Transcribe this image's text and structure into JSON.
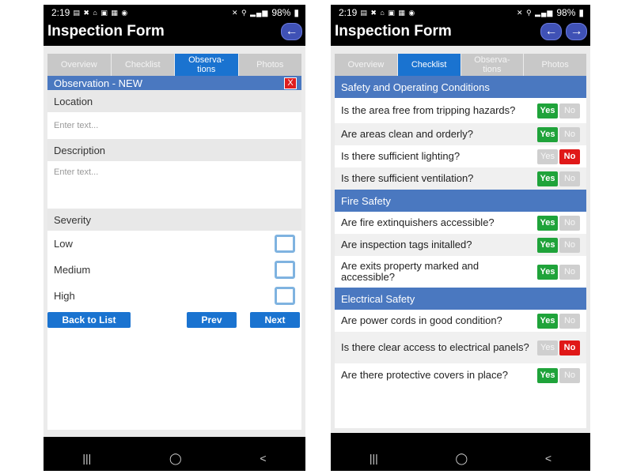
{
  "status": {
    "time": "2:19",
    "battery": "98%"
  },
  "app": {
    "title": "Inspection Form"
  },
  "tabs": [
    "Overview",
    "Checklist",
    "Observa-\ntions",
    "Photos"
  ],
  "left": {
    "observation_header": "Observation - NEW",
    "close_label": "X",
    "location_label": "Location",
    "location_placeholder": "Enter text...",
    "description_label": "Description",
    "description_placeholder": "Enter text...",
    "severity_label": "Severity",
    "severity_options": [
      "Low",
      "Medium",
      "High"
    ],
    "back_label": "Back to List",
    "prev_label": "Prev",
    "next_label": "Next"
  },
  "checklist": {
    "yes_label": "Yes",
    "no_label": "No",
    "sections": [
      {
        "title": "Safety and Operating Conditions",
        "items": [
          {
            "q": "Is the area free from tripping hazards?",
            "answer": "yes"
          },
          {
            "q": "Are areas clean and orderly?",
            "answer": "yes"
          },
          {
            "q": "Is there sufficient lighting?",
            "answer": "no"
          },
          {
            "q": "Is there sufficient ventilation?",
            "answer": "yes"
          }
        ]
      },
      {
        "title": "Fire Safety",
        "items": [
          {
            "q": "Are fire extinquishers accessible?",
            "answer": "yes"
          },
          {
            "q": "Are inspection tags initalled?",
            "answer": "yes"
          },
          {
            "q": "Are exits property marked and accessible?",
            "answer": "yes"
          }
        ]
      },
      {
        "title": "Electrical Safety",
        "items": [
          {
            "q": "Are power cords in good condition?",
            "answer": "yes"
          },
          {
            "q": "Is there clear access to electrical panels?",
            "answer": "no"
          },
          {
            "q": "Are there protective covers in place?",
            "answer": "yes"
          }
        ]
      }
    ]
  },
  "android_nav": {
    "recents": "|||",
    "home": "◯",
    "back": "<"
  },
  "colors": {
    "tab_active": "#1a73d0",
    "section_header": "#4a78c0",
    "yes_on": "#1fa33a",
    "no_on": "#e01818",
    "nav_button": "#3f51b5"
  }
}
